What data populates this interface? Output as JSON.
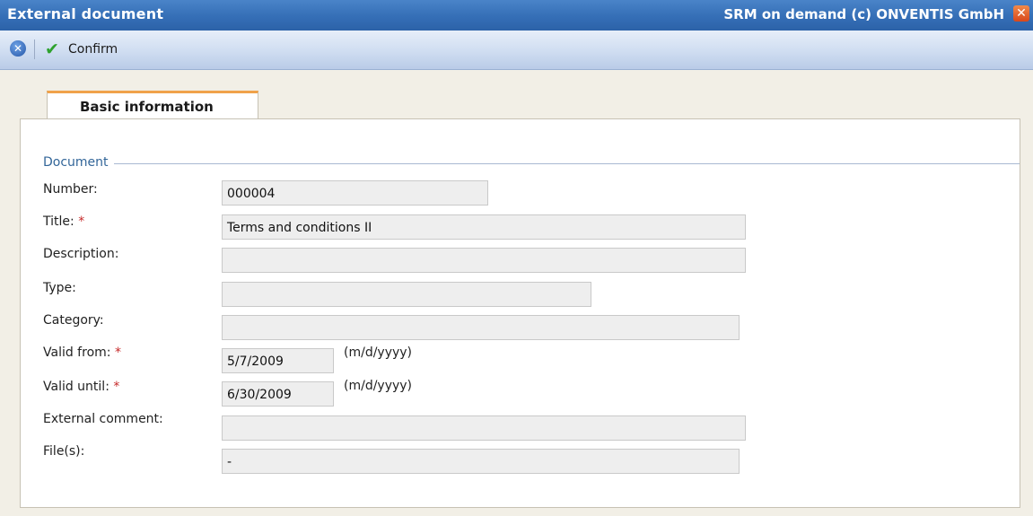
{
  "window": {
    "title": "External document",
    "vendor_text": "SRM on demand (c) ONVENTIS GmbH",
    "close_glyph": "✕"
  },
  "toolbar": {
    "cancel_icon": "cancel-icon",
    "cancel_glyph": "✕",
    "confirm_icon": "check-icon",
    "confirm_glyph": "✔",
    "confirm_label": "Confirm"
  },
  "tabs": [
    {
      "label": "Basic information",
      "active": true
    }
  ],
  "section": {
    "legend": "Document"
  },
  "form": {
    "number": {
      "label": "Number:",
      "value": "000004"
    },
    "title": {
      "label": "Title:",
      "required_marker": "*",
      "value": "Terms and conditions II"
    },
    "description": {
      "label": "Description:",
      "value": ""
    },
    "type": {
      "label": "Type:",
      "value": ""
    },
    "category": {
      "label": "Category:",
      "value": ""
    },
    "valid_from": {
      "label": "Valid from:",
      "required_marker": "*",
      "value": "5/7/2009",
      "format_hint": "(m/d/yyyy)"
    },
    "valid_until": {
      "label": "Valid until:",
      "required_marker": "*",
      "value": "6/30/2009",
      "format_hint": "(m/d/yyyy)"
    },
    "external_comment": {
      "label": "External comment:",
      "value": ""
    },
    "files": {
      "label": "File(s):",
      "value": "-"
    }
  },
  "colors": {
    "titlebar": "#3670b8",
    "tab_accent": "#f0a24a",
    "legend_text": "#336699",
    "required_marker": "#c62a2a",
    "confirm_check": "#2ea22e",
    "close_button": "#d8471b"
  }
}
